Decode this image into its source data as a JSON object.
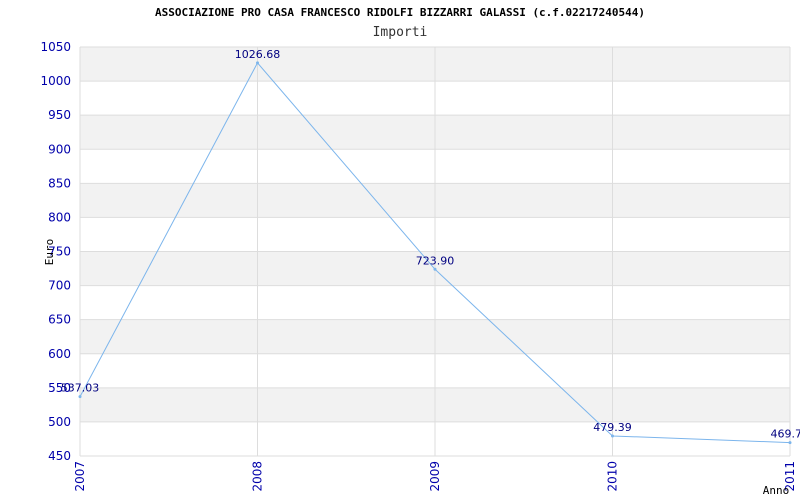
{
  "title": "ASSOCIAZIONE PRO CASA FRANCESCO RIDOLFI BIZZARRI GALASSI (c.f.02217240544)",
  "subtitle": "Importi",
  "colors": {
    "line": "#7cb5ec",
    "tick_text": "#0000aa",
    "data_label": "#000080",
    "band": "#f2f2f2",
    "grid": "#dddddd"
  },
  "chart_data": {
    "type": "line",
    "title": "ASSOCIAZIONE PRO CASA FRANCESCO RIDOLFI BIZZARRI GALASSI (c.f.02217240544)",
    "subtitle": "Importi",
    "xlabel": "Anno",
    "ylabel": "Euro",
    "categories": [
      "2007",
      "2008",
      "2009",
      "2010",
      "2011"
    ],
    "values": [
      537.03,
      1026.68,
      723.9,
      479.39,
      469.7
    ],
    "data_labels": [
      "537.03",
      "1026.68",
      "723.90",
      "479.39",
      "469.7"
    ],
    "yticks": [
      450,
      500,
      550,
      600,
      650,
      700,
      750,
      800,
      850,
      900,
      950,
      1000,
      1050
    ],
    "ylim": [
      450,
      1050
    ],
    "grid": true,
    "legend": "none"
  }
}
